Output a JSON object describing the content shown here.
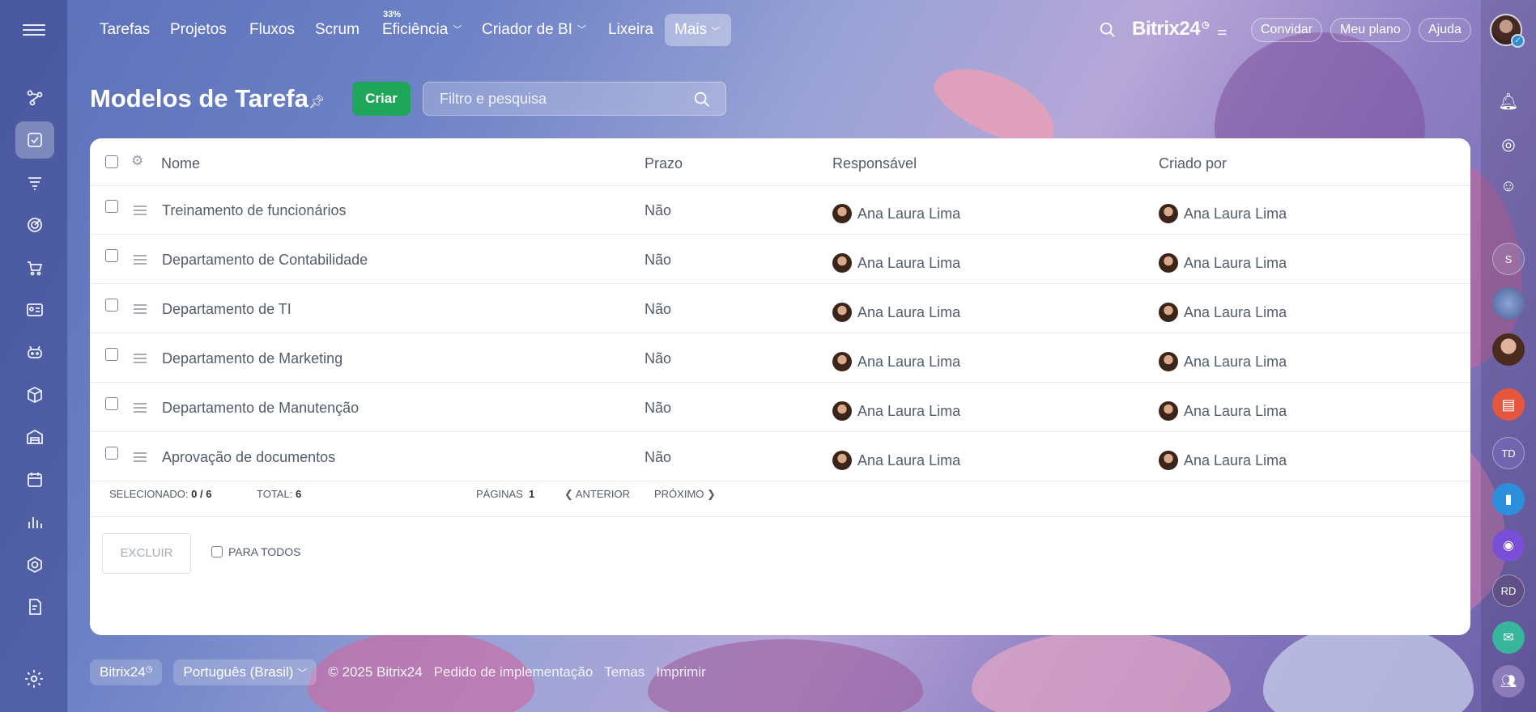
{
  "topnav": {
    "items": [
      "Tarefas",
      "Projetos",
      "Fluxos",
      "Scrum",
      "Eficiência",
      "Criador de BI",
      "Lixeira"
    ],
    "efficiency_badge": "33%",
    "more": "Mais",
    "brand": "Bitrix24",
    "invite": "Convidar",
    "plan": "Meu plano",
    "help": "Ajuda"
  },
  "page": {
    "title": "Modelos de Tarefa",
    "create": "Criar",
    "filter_placeholder": "Filtro e pesquisa"
  },
  "table": {
    "columns": {
      "name": "Nome",
      "deadline": "Prazo",
      "responsible": "Responsável",
      "created_by": "Criado por"
    },
    "rows": [
      {
        "name": "Treinamento de funcionários",
        "deadline": "Não",
        "responsible": "Ana Laura Lima",
        "created_by": "Ana Laura Lima"
      },
      {
        "name": "Departamento de Contabilidade",
        "deadline": "Não",
        "responsible": "Ana Laura Lima",
        "created_by": "Ana Laura Lima"
      },
      {
        "name": "Departamento de TI",
        "deadline": "Não",
        "responsible": "Ana Laura Lima",
        "created_by": "Ana Laura Lima"
      },
      {
        "name": "Departamento de Marketing",
        "deadline": "Não",
        "responsible": "Ana Laura Lima",
        "created_by": "Ana Laura Lima"
      },
      {
        "name": "Departamento de Manutenção",
        "deadline": "Não",
        "responsible": "Ana Laura Lima",
        "created_by": "Ana Laura Lima"
      },
      {
        "name": "Aprovação de documentos",
        "deadline": "Não",
        "responsible": "Ana Laura Lima",
        "created_by": "Ana Laura Lima"
      }
    ],
    "footer": {
      "selected_label": "SELECIONADO:",
      "selected_value": "0 / 6",
      "total_label": "TOTAL:",
      "total_value": "6",
      "pages_label": "PÁGINAS",
      "pages_value": "1",
      "prev": "ANTERIOR",
      "next": "PRÓXIMO"
    },
    "actions": {
      "delete": "EXCLUIR",
      "for_all": "PARA TODOS"
    }
  },
  "bottom_footer": {
    "brand": "Bitrix24",
    "language": "Português (Brasil)",
    "copyright": "© 2025 Bitrix24",
    "links": [
      "Pedido de implementação",
      "Temas",
      "Imprimir"
    ]
  },
  "rail": {
    "initials": [
      "S",
      "TD",
      "RD"
    ]
  },
  "colors": {
    "accent_green": "#1fa65b",
    "text": "#535c69",
    "online": "#2fa8f0"
  }
}
